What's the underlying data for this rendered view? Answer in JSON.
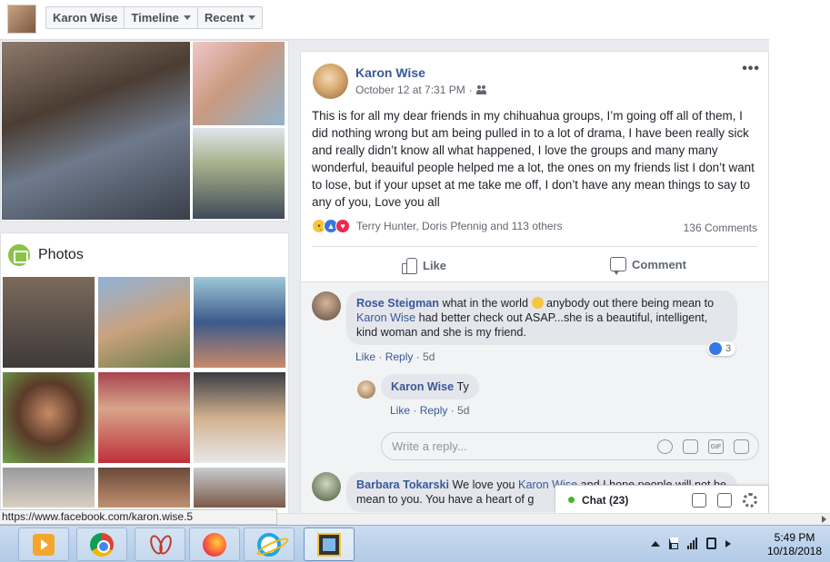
{
  "topbar": {
    "profile_name": "Karon Wise",
    "crumbs": [
      {
        "label": "Karon Wise",
        "has_caret": false
      },
      {
        "label": "Timeline",
        "has_caret": true
      },
      {
        "label": "Recent",
        "has_caret": true
      }
    ]
  },
  "photos_card": {
    "title": "Photos",
    "icon": "photos-icon"
  },
  "post": {
    "author": "Karon Wise",
    "date": "October 12 at 7:31 PM",
    "separator": "·",
    "audience_icon": "friends-icon",
    "more_label": "•••",
    "text": "This is for all my dear friends in my chihuahua groups, I’m going off all of them, I did nothing wrong but am being pulled in to a lot of drama, I have been really sick and really didn’t know all what happened, I love the groups and many many wonderful, beauiful people helped me a lot, the ones on my friends list I don’t want to lose, but if your upset at me take me off, I don’t have any mean things to say to any of you, Love you all",
    "reactions": {
      "types": [
        "sad",
        "like",
        "love"
      ],
      "names": "Terry Hunter, Doris Pfennig and 113 others"
    },
    "comments_count": "136 Comments",
    "actions": {
      "like": "Like",
      "comment": "Comment"
    }
  },
  "comments": [
    {
      "author": "Rose Steigman",
      "text_before": "what in the world",
      "text_mid": "anybody out there being mean to",
      "mention": "Karon Wise",
      "text_after": "had better check out ASAP...she is a beautiful, intelligent, kind woman and she is my friend.",
      "actions": {
        "like": "Like",
        "reply": "Reply",
        "time": "5d"
      },
      "like_count": "3"
    },
    {
      "author": "Karon Wise",
      "text": "Ty",
      "actions": {
        "like": "Like",
        "reply": "Reply",
        "time": "5d"
      }
    },
    {
      "author": "Barbara Tokarski",
      "text_before": "We love you",
      "mention": "Karon Wise",
      "text_after": "and I hope people will not be mean to you. You have a heart of g"
    }
  ],
  "reply_box": {
    "placeholder": "Write a reply..."
  },
  "chat": {
    "label": "Chat (23)",
    "status_color": "#42b72a"
  },
  "status_bar": {
    "url": "https://www.facebook.com/karon.wise.5"
  },
  "taskbar": {
    "apps": [
      "media-player-icon",
      "chrome-icon",
      "snipping-tool-icon",
      "firefox-icon",
      "internet-explorer-icon",
      "filmstrip-app-icon"
    ],
    "clock": {
      "time": "5:49 PM",
      "date": "10/18/2018"
    }
  },
  "colors": {
    "link": "#385898",
    "like_blue": "#3578e5",
    "love_red": "#f0284a"
  }
}
